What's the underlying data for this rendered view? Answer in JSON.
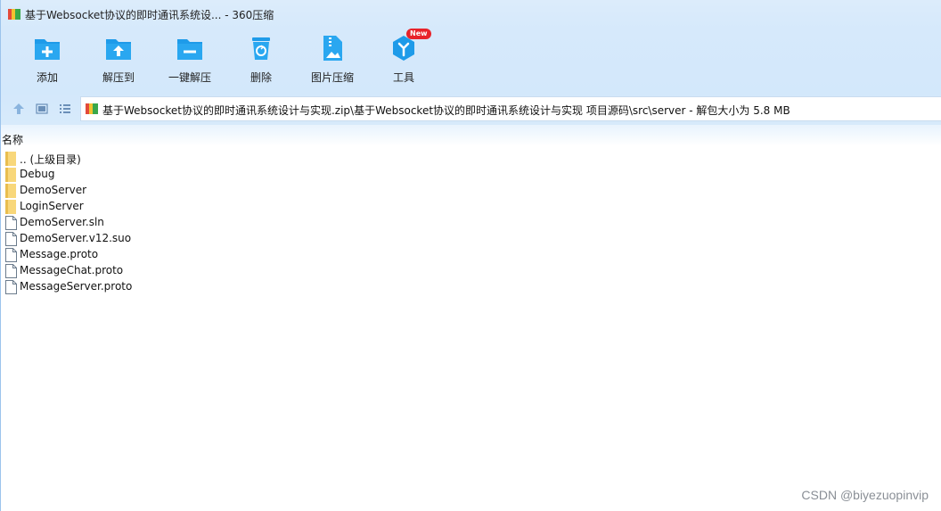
{
  "window": {
    "title": "基于Websocket协议的即时通讯系统设... - 360压缩"
  },
  "toolbar": {
    "items": [
      {
        "label": "添加",
        "icon": "add-icon"
      },
      {
        "label": "解压到",
        "icon": "extract-to-icon"
      },
      {
        "label": "一键解压",
        "icon": "one-click-extract-icon"
      },
      {
        "label": "删除",
        "icon": "trash-icon"
      },
      {
        "label": "图片压缩",
        "icon": "image-compress-icon"
      },
      {
        "label": "工具",
        "icon": "tools-icon",
        "badge": "New"
      }
    ]
  },
  "addressbar": {
    "path": "基于Websocket协议的即时通讯系统设计与实现.zip\\基于Websocket协议的即时通讯系统设计与实现 项目源码\\src\\server - 解包大小为 5.8 MB"
  },
  "list": {
    "column_name": "名称",
    "files": [
      {
        "name": ".. (上级目录)",
        "type": "folder"
      },
      {
        "name": "Debug",
        "type": "folder"
      },
      {
        "name": "DemoServer",
        "type": "folder"
      },
      {
        "name": "LoginServer",
        "type": "folder"
      },
      {
        "name": "DemoServer.sln",
        "type": "file"
      },
      {
        "name": "DemoServer.v12.suo",
        "type": "file"
      },
      {
        "name": "Message.proto",
        "type": "file"
      },
      {
        "name": "MessageChat.proto",
        "type": "file"
      },
      {
        "name": "MessageServer.proto",
        "type": "file"
      }
    ]
  },
  "watermark": "CSDN @biyezuopinvip",
  "colors": {
    "accent": "#1e9be9",
    "toolbar_bg": "#d6e9fb",
    "folder": "#f8d77a",
    "badge": "#e8232a"
  }
}
